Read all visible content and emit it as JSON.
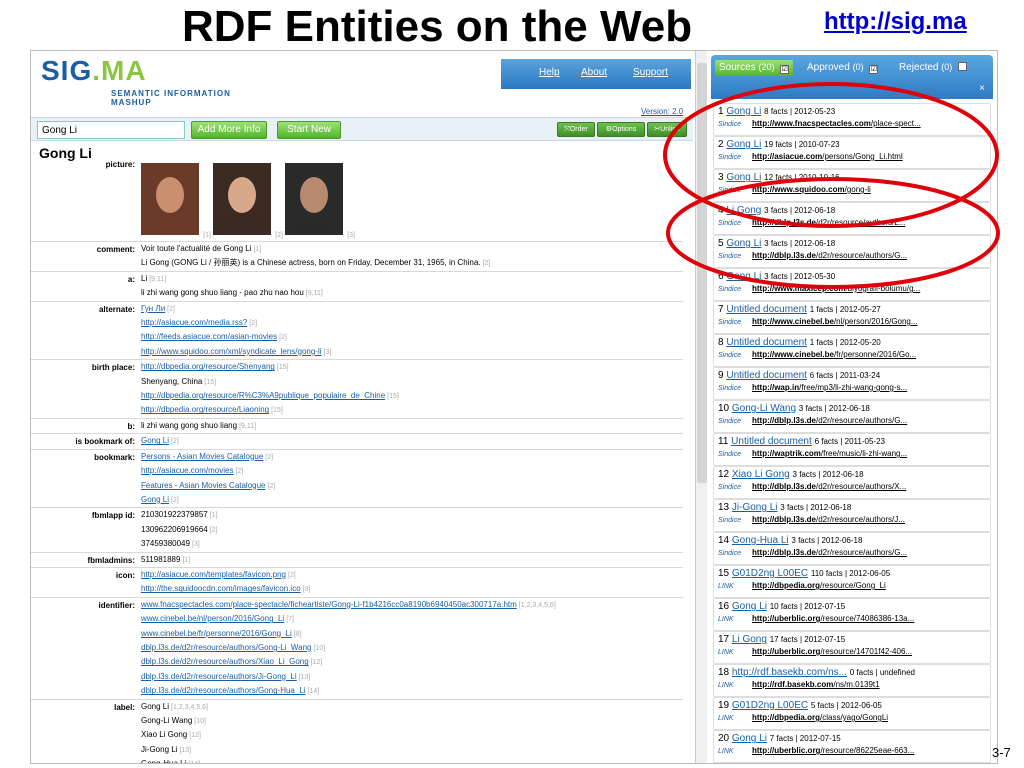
{
  "slide": {
    "title": "RDF Entities on the Web",
    "link": "http://sig.ma",
    "page_num": "3-7"
  },
  "app": {
    "logo": "SIG.MA",
    "logo_sub_1": "SEMANTIC INFORMATION",
    "logo_sub_2": "MASHUP",
    "nav": [
      "Help",
      "About",
      "Support"
    ],
    "version": "Version: 2.0",
    "search_value": "Gong Li",
    "add_more_label": "Add More Info",
    "start_new_label": "Start New",
    "order_label": "Order",
    "options_label": "Options",
    "unlink_label": "Unlink",
    "entity_title": "Gong Li"
  },
  "properties": [
    {
      "label": "picture:",
      "pictures": [
        {
          "ref": "[1]"
        },
        {
          "ref": "[2]"
        },
        {
          "ref": "[3]"
        }
      ]
    },
    {
      "label": "comment:",
      "values": [
        {
          "text": "Voir toute l'actualité de Gong Li",
          "ref": "[1]",
          "link": false
        },
        {
          "text": "Li Gong (GONG Li / 孙丽英) is a Chinese actress, born on Friday, December 31, 1965, in China.",
          "ref": "[2]",
          "link": false
        }
      ]
    },
    {
      "label": "a:",
      "values": [
        {
          "text": "Li",
          "ref": "[9,11]",
          "link": false
        },
        {
          "text": "li zhi wang gong shuo liang - pao zhu nao hou",
          "ref": "[9,11]",
          "link": false
        }
      ]
    },
    {
      "label": "alternate:",
      "values": [
        {
          "text": "Гун Ли",
          "ref": "[2]",
          "link": true
        },
        {
          "text": "http://asiacue.com/media.rss?",
          "ref": "[2]",
          "link": true
        },
        {
          "text": "http://feeds.asiacue.com/asian-movies",
          "ref": "[2]",
          "link": true
        },
        {
          "text": "http://www.squidoo.com/xml/syndicate_lens/gong-li",
          "ref": "[3]",
          "link": true
        }
      ]
    },
    {
      "label": "birth place:",
      "values": [
        {
          "text": "http://dbpedia.org/resource/Shenyang",
          "ref": "[15]",
          "link": true
        },
        {
          "text": "Shenyang, China",
          "ref": "[15]",
          "link": false
        },
        {
          "text": "http://dbpedia.org/resource/R%C3%A9publique_populaire_de_Chine",
          "ref": "[15]",
          "link": true
        },
        {
          "text": "http://dbpedia.org/resource/Liaoning",
          "ref": "[15]",
          "link": true
        }
      ]
    },
    {
      "label": "b:",
      "values": [
        {
          "text": "li zhi wang gong shuo liang",
          "ref": "[9,11]",
          "link": false
        }
      ]
    },
    {
      "label": "is bookmark of:",
      "values": [
        {
          "text": "Gong Li",
          "ref": "[2]",
          "link": true
        }
      ]
    },
    {
      "label": "bookmark:",
      "values": [
        {
          "text": "Persons - Asian Movies Catalogue",
          "ref": "[2]",
          "link": true
        },
        {
          "text": "http://asiacue.com/movies",
          "ref": "[2]",
          "link": true
        },
        {
          "text": "Features - Asian Movies Catalogue",
          "ref": "[2]",
          "link": true
        },
        {
          "text": "Gong Li",
          "ref": "[2]",
          "link": true
        }
      ]
    },
    {
      "label": "fbmlapp id:",
      "values": [
        {
          "text": "210301922379857",
          "ref": "[1]",
          "link": false
        },
        {
          "text": "130962206919664",
          "ref": "[2]",
          "link": false
        },
        {
          "text": "37459380049",
          "ref": "[3]",
          "link": false
        }
      ]
    },
    {
      "label": "fbmladmins:",
      "values": [
        {
          "text": "511981889",
          "ref": "[1]",
          "link": false
        }
      ]
    },
    {
      "label": "icon:",
      "values": [
        {
          "text": "http://asiacue.com/templates/favicon.png",
          "ref": "[2]",
          "link": true
        },
        {
          "text": "http://the.squidoocdn.com/images/favicon.ico",
          "ref": "[3]",
          "link": true
        }
      ]
    },
    {
      "label": "identifier:",
      "values": [
        {
          "text": "www.fnacspectacles.com/place-spectacle/ficheartiste/Gong-Li-f1b4216cc0a8190b6940450ac300717a.htm",
          "ref": "[1,2,3,4,5,6]",
          "link": true
        },
        {
          "text": "www.cinebel.be/nl/person/2016/Gong_Li",
          "ref": "[7]",
          "link": true
        },
        {
          "text": "www.cinebel.be/fr/personne/2016/Gong_Li",
          "ref": "[8]",
          "link": true
        },
        {
          "text": "dblp.l3s.de/d2r/resource/authors/Gong-Li_Wang",
          "ref": "[10]",
          "link": true
        },
        {
          "text": "dblp.l3s.de/d2r/resource/authors/Xiao_Li_Gong",
          "ref": "[12]",
          "link": true
        },
        {
          "text": "dblp.l3s.de/d2r/resource/authors/Ji-Gong_Li",
          "ref": "[13]",
          "link": true
        },
        {
          "text": "dblp.l3s.de/d2r/resource/authors/Gong-Hua_Li",
          "ref": "[14]",
          "link": true
        }
      ]
    },
    {
      "label": "label:",
      "values": [
        {
          "text": "Gong Li",
          "ref": "[1,2,3,4,5,6]",
          "link": false
        },
        {
          "text": "Gong-Li Wang",
          "ref": "[10]",
          "link": false
        },
        {
          "text": "Xiao Li Gong",
          "ref": "[12]",
          "link": false
        },
        {
          "text": "Ji-Gong Li",
          "ref": "[13]",
          "link": false
        },
        {
          "text": "Gong-Hua Li",
          "ref": "[14]",
          "link": false
        }
      ]
    }
  ],
  "sidebar": {
    "tabs": [
      {
        "label": "Sources",
        "count": "(20)",
        "checked": "☑"
      },
      {
        "label": "Approved",
        "count": "(0)",
        "checked": "☑"
      },
      {
        "label": "Rejected",
        "count": "(0)",
        "checked": ""
      }
    ],
    "close": "×",
    "sources": [
      {
        "num": "1",
        "title": "Gong Li",
        "meta": "8 facts | 2012-05-23",
        "prov": "Sindice",
        "domain": "http://www.fnacspectacles.com",
        "path": "/place-spect..."
      },
      {
        "num": "2",
        "title": "Gong Li",
        "meta": "19 facts | 2010-07-23",
        "prov": "Sindice",
        "domain": "http://asiacue.com",
        "path": "/persons/Gong_Li.html"
      },
      {
        "num": "3",
        "title": "Gong Li",
        "meta": "12 facts | 2010-10-16",
        "prov": "Sindice",
        "domain": "http://www.squidoo.com",
        "path": "/gong-li"
      },
      {
        "num": "4",
        "title": "Li Gong",
        "meta": "3 facts | 2012-06-18",
        "prov": "Sindice",
        "domain": "http://dblp.l3s.de",
        "path": "/d2r/resource/authors/L..."
      },
      {
        "num": "5",
        "title": "Gong Li",
        "meta": "3 facts | 2012-06-18",
        "prov": "Sindice",
        "domain": "http://dblp.l3s.de",
        "path": "/d2r/resource/authors/G..."
      },
      {
        "num": "6",
        "title": "Gong Li",
        "meta": "3 facts | 2012-05-30",
        "prov": "Sindice",
        "domain": "http://www.maxicep.com",
        "path": "/biyografi-bolumu/g..."
      },
      {
        "num": "7",
        "title": "Untitled document",
        "meta": "1 facts | 2012-05-27",
        "prov": "Sindice",
        "domain": "http://www.cinebel.be",
        "path": "/nl/person/2016/Gong..."
      },
      {
        "num": "8",
        "title": "Untitled document",
        "meta": "1 facts | 2012-05-20",
        "prov": "Sindice",
        "domain": "http://www.cinebel.be",
        "path": "/fr/personne/2016/Go..."
      },
      {
        "num": "9",
        "title": "Untitled document",
        "meta": "6 facts | 2011-03-24",
        "prov": "Sindice",
        "domain": "http://wap.in",
        "path": "/free/mp3/li-zhi-wang-gong-s..."
      },
      {
        "num": "10",
        "title": "Gong-Li Wang",
        "meta": "3 facts | 2012-06-18",
        "prov": "Sindice",
        "domain": "http://dblp.l3s.de",
        "path": "/d2r/resource/authors/G..."
      },
      {
        "num": "11",
        "title": "Untitled document",
        "meta": "6 facts | 2011-05-23",
        "prov": "Sindice",
        "domain": "http://waptrik.com",
        "path": "/free/music/li-zhi-wang..."
      },
      {
        "num": "12",
        "title": "Xiao Li Gong",
        "meta": "3 facts | 2012-06-18",
        "prov": "Sindice",
        "domain": "http://dblp.l3s.de",
        "path": "/d2r/resource/authors/X..."
      },
      {
        "num": "13",
        "title": "Ji-Gong Li",
        "meta": "3 facts | 2012-06-18",
        "prov": "Sindice",
        "domain": "http://dblp.l3s.de",
        "path": "/d2r/resource/authors/J..."
      },
      {
        "num": "14",
        "title": "Gong-Hua Li",
        "meta": "3 facts | 2012-06-18",
        "prov": "Sindice",
        "domain": "http://dblp.l3s.de",
        "path": "/d2r/resource/authors/G..."
      },
      {
        "num": "15",
        "title": "G01D2ng L00EC",
        "meta": "110 facts | 2012-06-05",
        "prov": "LINK",
        "domain": "http://dbpedia.org",
        "path": "/resource/Gong_Li"
      },
      {
        "num": "16",
        "title": "Gong Li",
        "meta": "10 facts | 2012-07-15",
        "prov": "LINK",
        "domain": "http://uberblic.org",
        "path": "/resource/74086386-13a..."
      },
      {
        "num": "17",
        "title": "Li Gong",
        "meta": "17 facts | 2012-07-15",
        "prov": "LINK",
        "domain": "http://uberblic.org",
        "path": "/resource/14701f42-406..."
      },
      {
        "num": "18",
        "title": "http://rdf.basekb.com/ns...",
        "meta": "0 facts | undefined",
        "prov": "LINK",
        "domain": "http://rdf.basekb.com",
        "path": "/ns/m.0139t1"
      },
      {
        "num": "19",
        "title": "G01D2ng L00EC",
        "meta": "5 facts | 2012-06-05",
        "prov": "LINK",
        "domain": "http://dbpedia.org",
        "path": "/class/yago/GongLi"
      },
      {
        "num": "20",
        "title": "Gong Li",
        "meta": "7 facts | 2012-07-15",
        "prov": "LINK",
        "domain": "http://uberblic.org",
        "path": "/resource/86225eae-663..."
      }
    ]
  },
  "colors": {
    "link_blue": "#1a5fa6",
    "green_button": "#52b52a",
    "header_blue": "#2f7bc4",
    "highlight_oval": "#e0000a"
  },
  "icons": {
    "order": "order-icon",
    "options": "gear-icon",
    "unlink": "unlink-icon",
    "close": "close-icon",
    "scroll": "scrollbar"
  }
}
